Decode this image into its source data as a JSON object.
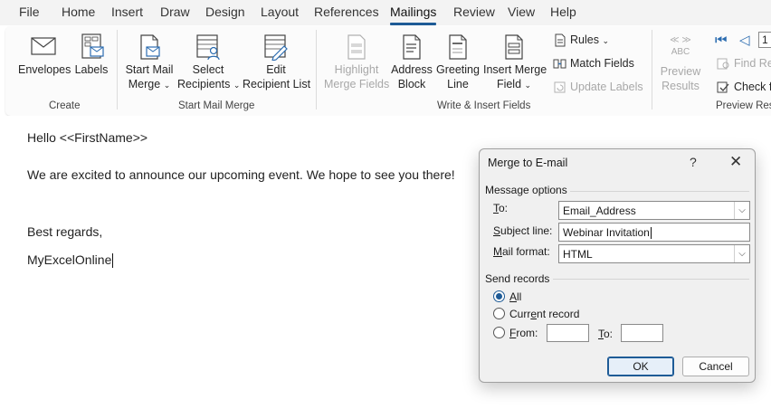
{
  "menu": {
    "items": [
      "File",
      "Home",
      "Insert",
      "Draw",
      "Design",
      "Layout",
      "References",
      "Mailings",
      "Review",
      "View",
      "Help"
    ],
    "active": "Mailings"
  },
  "ribbon": {
    "create": {
      "label": "Create",
      "envelopes": "Envelopes",
      "labels": "Labels"
    },
    "start_mail_merge": {
      "label": "Start Mail Merge",
      "start_line1": "Start Mail",
      "start_line2": "Merge",
      "select_line1": "Select",
      "select_line2": "Recipients",
      "edit_line1": "Edit",
      "edit_line2": "Recipient List"
    },
    "write_insert": {
      "label": "Write & Insert Fields",
      "highlight_line1": "Highlight",
      "highlight_line2": "Merge Fields",
      "address_line1": "Address",
      "address_line2": "Block",
      "greeting_line1": "Greeting",
      "greeting_line2": "Line",
      "insert_line1": "Insert Merge",
      "insert_line2": "Field",
      "rules": "Rules",
      "match_fields": "Match Fields",
      "update_labels": "Update Labels"
    },
    "preview": {
      "label": "Preview Res",
      "preview_line1": "Preview",
      "preview_line2": "Results",
      "abc": "ABC",
      "record_number": "1",
      "find_recipient": "Find Re",
      "check_errors": "Check f"
    }
  },
  "document": {
    "line1": "Hello <<FirstName>>",
    "line2": "We are excited to announce our upcoming event. We hope to see you there!",
    "line3": "Best regards,",
    "line4": "MyExcelOnline"
  },
  "dialog": {
    "title": "Merge to E-mail",
    "help": "?",
    "close": "✕",
    "message_options": "Message options",
    "to_label_u": "T",
    "to_label_rest": "o:",
    "to_value": "Email_Address",
    "subject_label_u": "S",
    "subject_label_rest": "ubject line:",
    "subject_value": "Webinar Invitation",
    "format_label_u": "M",
    "format_label_rest": "ail format:",
    "format_value": "HTML",
    "send_records": "Send records",
    "all_u": "A",
    "all_rest": "ll",
    "current_pre": "Curr",
    "current_u": "e",
    "current_rest": "nt record",
    "from_u": "F",
    "from_rest": "rom:",
    "to2_u": "T",
    "to2_rest": "o:",
    "ok": "OK",
    "cancel": "Cancel",
    "selected_option": "All"
  },
  "colors": {
    "accent": "#1e5b96",
    "icon_blue": "#2b6cb0"
  }
}
